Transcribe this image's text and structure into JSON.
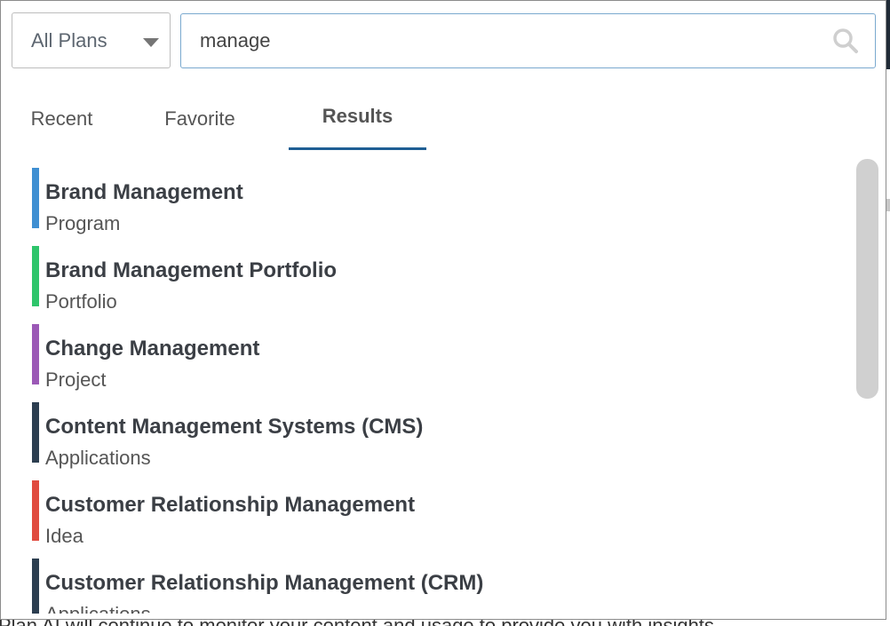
{
  "background": {
    "footer_text": "Plan AI will continue to monitor your content and usage to provide you with insights"
  },
  "filter": {
    "selected": "All Plans",
    "icon": "caret-down-icon"
  },
  "search": {
    "value": "manage",
    "icon": "search-icon"
  },
  "tabs": [
    {
      "label": "Recent",
      "active": false
    },
    {
      "label": "Favorite",
      "active": false
    },
    {
      "label": "Results",
      "active": true
    }
  ],
  "results": [
    {
      "title": "Brand Management",
      "type": "Program",
      "color": "#3f8fd2"
    },
    {
      "title": "Brand Management Portfolio",
      "type": "Portfolio",
      "color": "#2ec56b"
    },
    {
      "title": "Change Management",
      "type": "Project",
      "color": "#9b59b6"
    },
    {
      "title": "Content Management Systems (CMS)",
      "type": "Applications",
      "color": "#2c3e50"
    },
    {
      "title": "Customer Relationship Management",
      "type": "Idea",
      "color": "#e04b3f"
    },
    {
      "title": "Customer Relationship Management (CRM)",
      "type": "Applications",
      "color": "#2c3e50"
    }
  ],
  "colors": {
    "accent": "#1f5f94",
    "search_border": "#7aa9cf"
  }
}
